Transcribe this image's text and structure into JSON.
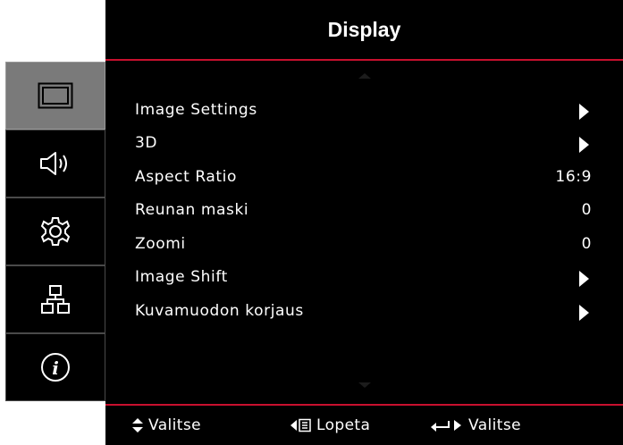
{
  "title": "Display",
  "sidebar": {
    "tabs": [
      {
        "icon": "display-icon",
        "active": true
      },
      {
        "icon": "speaker-icon",
        "active": false
      },
      {
        "icon": "gear-icon",
        "active": false
      },
      {
        "icon": "network-icon",
        "active": false
      },
      {
        "icon": "info-icon",
        "active": false
      }
    ]
  },
  "menu": {
    "items": [
      {
        "label": "Image Settings",
        "value": "",
        "submenu": true
      },
      {
        "label": "3D",
        "value": "",
        "submenu": true
      },
      {
        "label": "Aspect Ratio",
        "value": "16:9",
        "submenu": false
      },
      {
        "label": "Reunan maski",
        "value": "0",
        "submenu": false
      },
      {
        "label": "Zoomi",
        "value": "0",
        "submenu": false
      },
      {
        "label": "Image Shift",
        "value": "",
        "submenu": true
      },
      {
        "label": "Kuvamuodon korjaus",
        "value": "",
        "submenu": true
      }
    ]
  },
  "footer": {
    "select_label": "Valitse",
    "exit_label": "Lopeta",
    "enter_label": "Valitse"
  },
  "colors": {
    "accent": "#c8102e",
    "background": "#000000",
    "active_tab": "#7a7a7a"
  }
}
